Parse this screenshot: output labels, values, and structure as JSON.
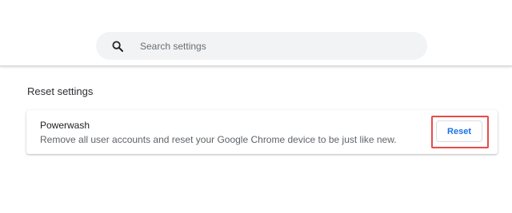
{
  "search": {
    "placeholder": "Search settings",
    "icon": "search-icon"
  },
  "section": {
    "title": "Reset settings"
  },
  "powerwash": {
    "title": "Powerwash",
    "description": "Remove all user accounts and reset your Google Chrome device to be just like new.",
    "button_label": "Reset"
  },
  "colors": {
    "accent": "#1a73e8",
    "highlight": "#e84a4a",
    "search_bg": "#f1f3f4"
  }
}
